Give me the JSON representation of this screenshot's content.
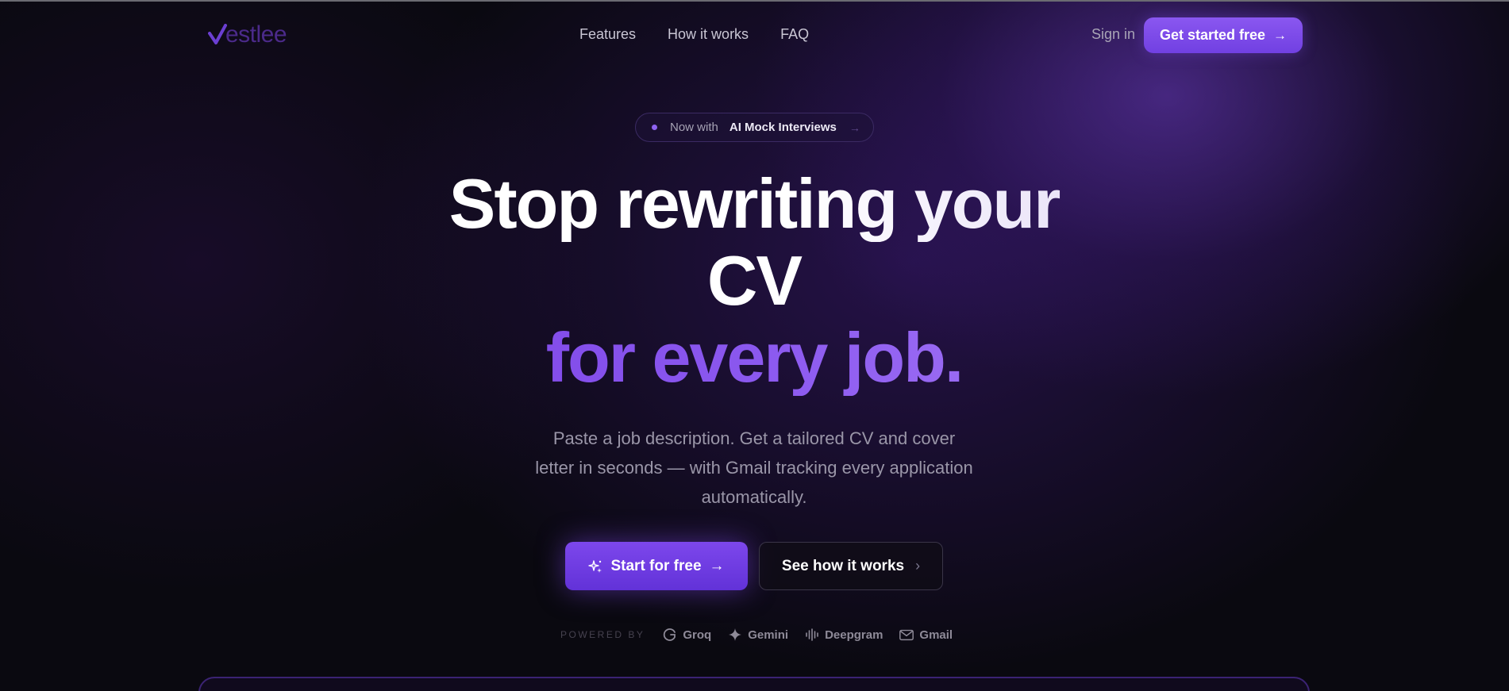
{
  "nav": {
    "logo_text": "estlee",
    "links": [
      "Features",
      "How it works",
      "FAQ"
    ],
    "signin": "Sign in",
    "cta": "Get started free"
  },
  "badge": {
    "prefix": "Now with",
    "feature": "AI Mock Interviews",
    "arrow": "→"
  },
  "hero": {
    "line1": "Stop rewriting your",
    "line2": "CV",
    "line3": "for every job.",
    "subtitle": "Paste a job description. Get a tailored CV and cover letter in seconds — with Gmail tracking every application automatically."
  },
  "buttons": {
    "primary": "Start for free",
    "secondary": "See how it works"
  },
  "powered_by": {
    "label": "POWERED BY",
    "items": [
      {
        "name": "Groq",
        "icon": "groq-icon"
      },
      {
        "name": "Gemini",
        "icon": "gemini-icon"
      },
      {
        "name": "Deepgram",
        "icon": "deepgram-icon"
      },
      {
        "name": "Gmail",
        "icon": "gmail-icon"
      }
    ]
  },
  "colors": {
    "accent": "#7c44e6",
    "background": "#0a0910",
    "muted_text": "#9a96a8"
  }
}
